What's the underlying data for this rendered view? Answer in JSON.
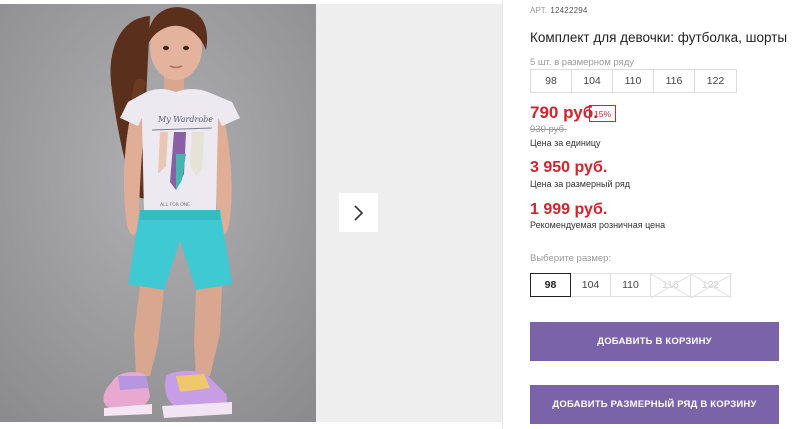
{
  "product": {
    "sku_label": "АРТ.",
    "sku": "12422294",
    "title": "Комплект для девочки: футболка, шорты"
  },
  "gallery": {
    "image_alt": "Девочка в футболке и шортах",
    "next_icon": "chevron-right-icon"
  },
  "pack": {
    "label": "5 шт. в размерном ряду",
    "sizes": [
      "98",
      "104",
      "110",
      "116",
      "122"
    ]
  },
  "prices": {
    "current": "790 руб.",
    "discount": "15%",
    "old": "930 руб.",
    "unit_label": "Цена за единицу",
    "pack": "3 950 руб.",
    "pack_label": "Цена за размерный ряд",
    "rrp": "1 999 руб.",
    "rrp_label": "Рекомендуемая розничная цена"
  },
  "size_select": {
    "label": "Выберите размер:",
    "options": [
      {
        "value": "98",
        "state": "selected"
      },
      {
        "value": "104",
        "state": "available"
      },
      {
        "value": "110",
        "state": "available"
      },
      {
        "value": "116",
        "state": "unavailable"
      },
      {
        "value": "122",
        "state": "unavailable"
      }
    ]
  },
  "actions": {
    "add_to_cart": "Добавить в корзину",
    "add_pack_to_cart": "Добавить размерный ряд в корзину"
  },
  "colors": {
    "price_red": "#d3232c",
    "button_purple": "#7b63a9",
    "photo_background": "#9a9a9c"
  }
}
